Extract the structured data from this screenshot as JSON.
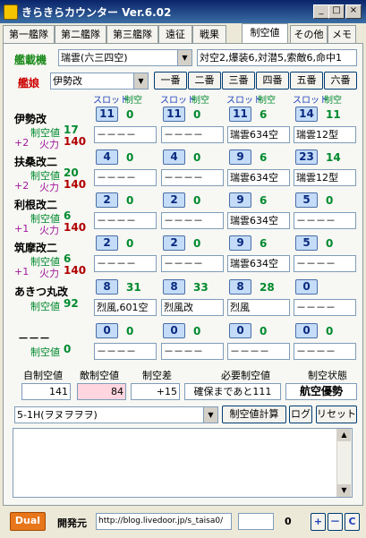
{
  "window": {
    "title": "きらきらカウンター  Ver.6.02",
    "min": "_",
    "max": "□",
    "close": "×"
  },
  "tabs": [
    "第一艦隊",
    "第二艦隊",
    "第三艦隊",
    "遠征",
    "戦果",
    "制空値",
    "その他",
    "メモ"
  ],
  "flagship": {
    "label": "艦載機",
    "combo": "瑞雲(六三四空)",
    "stats": "対空2,爆装6,対潜5,索敵6,命中1"
  },
  "ship_select": {
    "label": "艦娘",
    "combo": "伊勢改",
    "order_buttons": [
      "一番",
      "二番",
      "三番",
      "四番",
      "五番",
      "六番"
    ]
  },
  "column_headers": {
    "slot": "スロット",
    "air": "制空"
  },
  "ships": [
    {
      "name": "伊勢改",
      "sub": "制空値",
      "air": "17",
      "bonus": "+2",
      "fp_label": "火力",
      "fp": "140",
      "slots": [
        {
          "n": "11",
          "air": "0",
          "eq": "－－－－"
        },
        {
          "n": "11",
          "air": "0",
          "eq": "－－－－"
        },
        {
          "n": "11",
          "air": "6",
          "eq": "瑞雲634空"
        },
        {
          "n": "14",
          "air": "11",
          "eq": "瑞雲12型"
        }
      ]
    },
    {
      "name": "扶桑改二",
      "sub": "制空値",
      "air": "20",
      "bonus": "+2",
      "fp_label": "火力",
      "fp": "140",
      "slots": [
        {
          "n": "4",
          "air": "0",
          "eq": "－－－－"
        },
        {
          "n": "4",
          "air": "0",
          "eq": "－－－－"
        },
        {
          "n": "9",
          "air": "6",
          "eq": "瑞雲634空"
        },
        {
          "n": "23",
          "air": "14",
          "eq": "瑞雲12型"
        }
      ]
    },
    {
      "name": "利根改二",
      "sub": "制空値",
      "air": "6",
      "bonus": "+1",
      "fp_label": "火力",
      "fp": "140",
      "slots": [
        {
          "n": "2",
          "air": "0",
          "eq": "－－－－"
        },
        {
          "n": "2",
          "air": "0",
          "eq": "－－－－"
        },
        {
          "n": "9",
          "air": "6",
          "eq": "瑞雲634空"
        },
        {
          "n": "5",
          "air": "0",
          "eq": "－－－－"
        }
      ]
    },
    {
      "name": "筑摩改二",
      "sub": "制空値",
      "air": "6",
      "bonus": "+1",
      "fp_label": "火力",
      "fp": "140",
      "slots": [
        {
          "n": "2",
          "air": "0",
          "eq": "－－－－"
        },
        {
          "n": "2",
          "air": "0",
          "eq": "－－－－"
        },
        {
          "n": "9",
          "air": "6",
          "eq": "瑞雲634空"
        },
        {
          "n": "5",
          "air": "0",
          "eq": "－－－－"
        }
      ]
    },
    {
      "name": "あきつ丸改",
      "sub": "制空値",
      "air": "92",
      "bonus": "",
      "fp_label": "",
      "fp": "",
      "slots": [
        {
          "n": "8",
          "air": "31",
          "eq": "烈風,601空"
        },
        {
          "n": "8",
          "air": "33",
          "eq": "烈風改"
        },
        {
          "n": "8",
          "air": "28",
          "eq": "烈風"
        },
        {
          "n": "0",
          "air": "",
          "eq": "－－－－"
        }
      ]
    },
    {
      "name": "－－－",
      "sub": "制空値",
      "air": "0",
      "bonus": "",
      "fp_label": "",
      "fp": "",
      "slots": [
        {
          "n": "0",
          "air": "0",
          "eq": "－－－－"
        },
        {
          "n": "0",
          "air": "0",
          "eq": "－－－－"
        },
        {
          "n": "0",
          "air": "0",
          "eq": "－－－－"
        },
        {
          "n": "0",
          "air": "0",
          "eq": "－－－－"
        }
      ]
    }
  ],
  "summary": {
    "own_label": "自制空値",
    "own": "141",
    "enemy_label": "敵制空値",
    "enemy": "84",
    "diff_label": "制空差",
    "diff": "+15",
    "need_label": "必要制空値",
    "need": "確保まであと111",
    "state_label": "制空状態",
    "state": "航空優勢"
  },
  "map": {
    "combo": "5-1H(ヲヌヲヲヲ)",
    "calc_button": "制空値計算",
    "log_button": "ログ",
    "reset_button": "リセット"
  },
  "footer": {
    "dual": "Dual",
    "dev_label": "開発元",
    "url": "http://blog.livedoor.jp/s_taisa0/",
    "count": "0",
    "plus": "+",
    "minus": "－",
    "c": "C"
  },
  "colors": {
    "accent_blue": "#1a3fb8",
    "green": "#008a2e",
    "red": "#cc0000",
    "dual_orange": "#e8761a"
  }
}
